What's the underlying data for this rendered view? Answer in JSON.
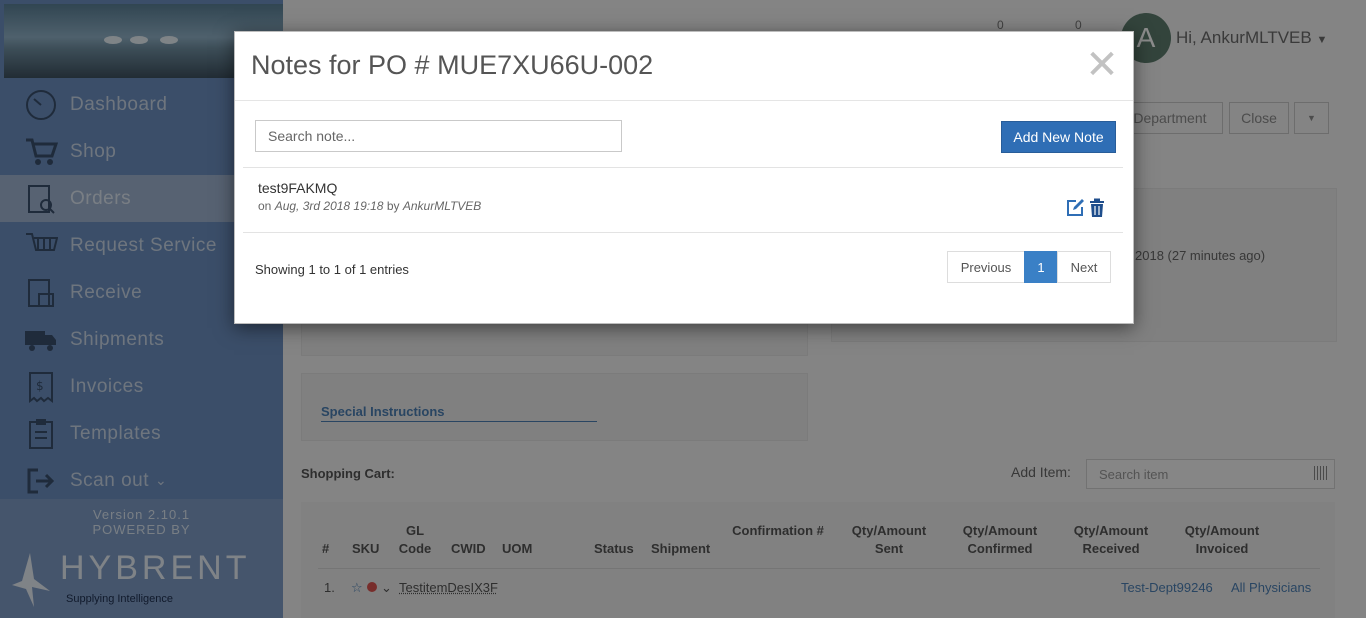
{
  "sidebar": {
    "items": [
      {
        "label": "Dashboard",
        "icon": "dashboard-icon"
      },
      {
        "label": "Shop",
        "icon": "cart-icon"
      },
      {
        "label": "Orders",
        "icon": "orders-icon",
        "active": true
      },
      {
        "label": "Request Service",
        "icon": "request-service-icon"
      },
      {
        "label": "Receive",
        "icon": "receive-icon"
      },
      {
        "label": "Shipments",
        "icon": "truck-icon"
      },
      {
        "label": "Invoices",
        "icon": "invoice-icon"
      },
      {
        "label": "Templates",
        "icon": "templates-icon"
      },
      {
        "label": "Scan out",
        "icon": "scan-out-icon"
      }
    ],
    "version": "Version 2.10.1",
    "powered_by": "POWERED BY",
    "brand": "HYBRENT",
    "brand_tagline": "Supplying Intelligence"
  },
  "header": {
    "avatar_letter": "A",
    "greeting": "Hi, AnkurMLTVEB",
    "badge_counts": [
      "0",
      "0"
    ]
  },
  "toolbar": {
    "department_label": "/Department",
    "close_label": "Close"
  },
  "background": {
    "time_text": "2018 (27 minutes ago)",
    "special_instructions": "Special Instructions",
    "shopping_cart": "Shopping Cart:",
    "add_item_label": "Add Item:",
    "search_item_placeholder": "Search item",
    "columns": [
      "#",
      "SKU",
      "GL Code",
      "CWID",
      "UOM",
      "Status",
      "Shipment",
      "Confirmation #",
      "Qty/Amount Sent",
      "Qty/Amount Confirmed",
      "Qty/Amount Received",
      "Qty/Amount Invoiced"
    ],
    "row": {
      "index": "1.",
      "item": "TestitemDesIX3F",
      "department": "Test-Dept99246",
      "physicians": "All Physicians"
    }
  },
  "modal": {
    "title": "Notes for PO # MUE7XU66U-002",
    "search_placeholder": "Search note...",
    "add_button": "Add New Note",
    "notes": [
      {
        "title": "test9FAKMQ",
        "prefix": "on",
        "date": "Aug, 3rd 2018 19:18",
        "by": "by",
        "author": "AnkurMLTVEB"
      }
    ],
    "entries_text": "Showing 1 to 1 of 1 entries",
    "pagination": {
      "previous": "Previous",
      "current": "1",
      "next": "Next"
    }
  },
  "colors": {
    "primary": "#2f6eb5",
    "sidebar": "#6c8fbf",
    "link": "#4b7fb3"
  }
}
